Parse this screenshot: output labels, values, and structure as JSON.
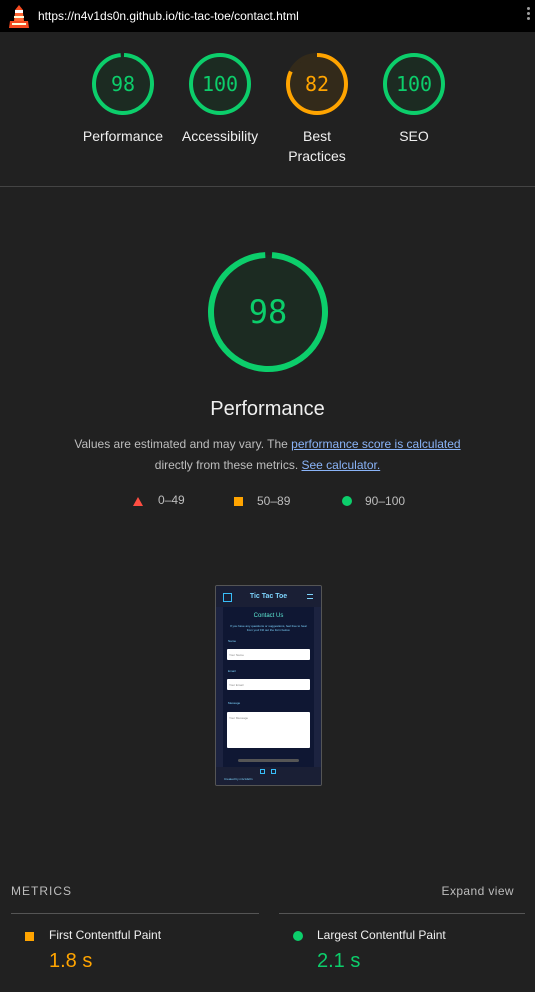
{
  "url_bar": {
    "url": "https://n4v1ds0n.github.io/tic-tac-toe/contact.html"
  },
  "colors": {
    "pass": "#0cce6b",
    "average": "#ffa400",
    "fail": "#ff4e42",
    "link": "#8ab4f8"
  },
  "gauges": [
    {
      "score": "98",
      "score_value": 98,
      "label": "Performance",
      "status": "pass"
    },
    {
      "score": "100",
      "score_value": 100,
      "label": "Accessibility",
      "status": "pass"
    },
    {
      "score": "82",
      "score_value": 82,
      "label_line1": "Best",
      "label_line2": "Practices",
      "status": "average"
    },
    {
      "score": "100",
      "score_value": 100,
      "label": "SEO",
      "status": "pass"
    }
  ],
  "performance": {
    "score": "98",
    "score_value": 98,
    "title": "Performance",
    "desc_prefix": "Values are estimated and may vary. The ",
    "desc_link": "performance score is calculated",
    "desc_mid": "directly from these metrics. ",
    "desc_link2": "See calculator."
  },
  "legend": [
    {
      "range": "0–49",
      "icon": "triangle-icon"
    },
    {
      "range": "50–89",
      "icon": "square-icon"
    },
    {
      "range": "90–100",
      "icon": "circle-icon"
    }
  ],
  "screenshot": {
    "site_title": "Tic Tac Toe",
    "heading": "Contact Us",
    "intro": "If you have any questions or suggestions, feel free to hear from you! Fill out the form below.",
    "name_label": "Name",
    "name_placeholder": "Your Name",
    "email_label": "Email",
    "email_placeholder": "Your Email",
    "message_label": "Message",
    "message_placeholder": "Your Message",
    "credit": "Created by n4v1ds0n"
  },
  "metrics": {
    "heading": "METRICS",
    "expand": "Expand view",
    "items": [
      {
        "name": "First Contentful Paint",
        "value": "1.8 s",
        "status": "average"
      },
      {
        "name": "Largest Contentful Paint",
        "value": "2.1 s",
        "status": "pass"
      }
    ]
  }
}
